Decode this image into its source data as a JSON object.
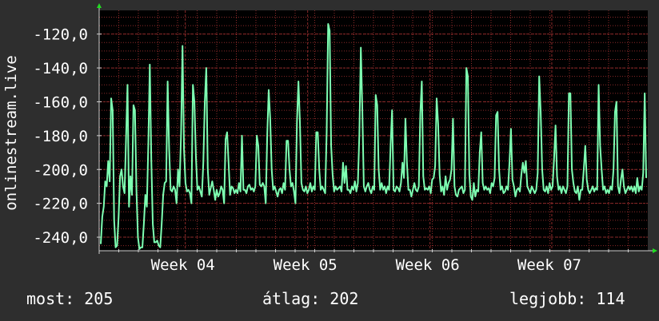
{
  "chart_data": {
    "type": "line",
    "ylabel": "onlinestream.live",
    "ylim": [
      -248,
      -106
    ],
    "y_ticks": [
      "-120,0",
      "-140,0",
      "-160,0",
      "-180,0",
      "-200,0",
      "-220,0",
      "-240,0"
    ],
    "y_tick_values": [
      -120,
      -140,
      -160,
      -180,
      -200,
      -220,
      -240
    ],
    "x_ticks": [
      "Week 04",
      "Week 05",
      "Week 06",
      "Week 07"
    ],
    "x_tick_positions": [
      0.157,
      0.38,
      0.603,
      0.825
    ],
    "grid": true,
    "series": [
      {
        "color": "#7effb2",
        "values": [
          -244,
          -228,
          -222,
          -207,
          -210,
          -195,
          -207,
          -158,
          -165,
          -230,
          -246,
          -245,
          -228,
          -204,
          -200,
          -210,
          -214,
          -182,
          -150,
          -222,
          -204,
          -215,
          -162,
          -165,
          -212,
          -240,
          -247,
          -246,
          -246,
          -232,
          -215,
          -222,
          -185,
          -138,
          -194,
          -232,
          -243,
          -243,
          -242,
          -245,
          -246,
          -232,
          -215,
          -208,
          -207,
          -148,
          -188,
          -212,
          -213,
          -210,
          -212,
          -220,
          -200,
          -210,
          -180,
          -127,
          -188,
          -208,
          -213,
          -212,
          -214,
          -220,
          -150,
          -160,
          -192,
          -212,
          -210,
          -213,
          -216,
          -196,
          -160,
          -140,
          -200,
          -215,
          -211,
          -207,
          -212,
          -218,
          -212,
          -216,
          -214,
          -210,
          -212,
          -220,
          -182,
          -178,
          -196,
          -215,
          -210,
          -211,
          -214,
          -212,
          -214,
          -208,
          -213,
          -180,
          -212,
          -212,
          -214,
          -210,
          -209,
          -212,
          -211,
          -213,
          -210,
          -180,
          -186,
          -209,
          -210,
          -208,
          -210,
          -220,
          -180,
          -153,
          -170,
          -200,
          -212,
          -210,
          -213,
          -216,
          -212,
          -211,
          -214,
          -208,
          -212,
          -183,
          -183,
          -200,
          -210,
          -208,
          -213,
          -220,
          -172,
          -148,
          -172,
          -208,
          -212,
          -213,
          -210,
          -214,
          -212,
          -208,
          -213,
          -210,
          -212,
          -178,
          -178,
          -200,
          -212,
          -210,
          -212,
          -214,
          -178,
          -114,
          -118,
          -186,
          -203,
          -213,
          -210,
          -212,
          -211,
          -210,
          -213,
          -196,
          -208,
          -198,
          -212,
          -212,
          -214,
          -210,
          -212,
          -207,
          -213,
          -208,
          -179,
          -128,
          -165,
          -210,
          -213,
          -210,
          -208,
          -212,
          -214,
          -210,
          -212,
          -156,
          -162,
          -200,
          -212,
          -208,
          -212,
          -210,
          -214,
          -210,
          -212,
          -186,
          -165,
          -212,
          -213,
          -210,
          -211,
          -213,
          -208,
          -196,
          -205,
          -170,
          -196,
          -212,
          -212,
          -216,
          -212,
          -208,
          -212,
          -213,
          -210,
          -167,
          -148,
          -204,
          -212,
          -211,
          -212,
          -210,
          -214,
          -206,
          -205,
          -198,
          -158,
          -173,
          -203,
          -213,
          -210,
          -215,
          -204,
          -212,
          -208,
          -206,
          -200,
          -170,
          -210,
          -215,
          -216,
          -212,
          -211,
          -210,
          -214,
          -212,
          -140,
          -145,
          -203,
          -216,
          -218,
          -208,
          -216,
          -212,
          -213,
          -190,
          -178,
          -208,
          -212,
          -210,
          -212,
          -211,
          -214,
          -208,
          -210,
          -205,
          -168,
          -166,
          -200,
          -212,
          -210,
          -214,
          -213,
          -210,
          -212,
          -196,
          -176,
          -206,
          -210,
          -216,
          -212,
          -211,
          -213,
          -203,
          -196,
          -202,
          -195,
          -210,
          -212,
          -214,
          -210,
          -212,
          -214,
          -212,
          -202,
          -145,
          -166,
          -200,
          -212,
          -213,
          -210,
          -214,
          -208,
          -212,
          -210,
          -194,
          -174,
          -204,
          -212,
          -210,
          -214,
          -210,
          -212,
          -214,
          -210,
          -155,
          -155,
          -200,
          -208,
          -213,
          -214,
          -210,
          -218,
          -212,
          -212,
          -200,
          -186,
          -206,
          -212,
          -214,
          -212,
          -210,
          -213,
          -211,
          -212,
          -150,
          -186,
          -200,
          -212,
          -210,
          -214,
          -212,
          -214,
          -210,
          -212,
          -200,
          -166,
          -160,
          -210,
          -214,
          -206,
          -200,
          -210,
          -214,
          -212,
          -210,
          -212,
          -210,
          -213,
          -210,
          -214,
          -205,
          -213,
          -210,
          -212,
          -202,
          -155,
          -205
        ]
      }
    ]
  },
  "stats": {
    "now": "most: 205",
    "average": "átlag: 202",
    "best": "legjobb: 114"
  },
  "colors": {
    "background": "#2e2e2e",
    "plot_background": "#000000",
    "line": "#7effb2",
    "grid": "#8c2a2a",
    "axis": "#cfcfcf",
    "arrow": "#22dd22",
    "text": "#ffffff"
  }
}
